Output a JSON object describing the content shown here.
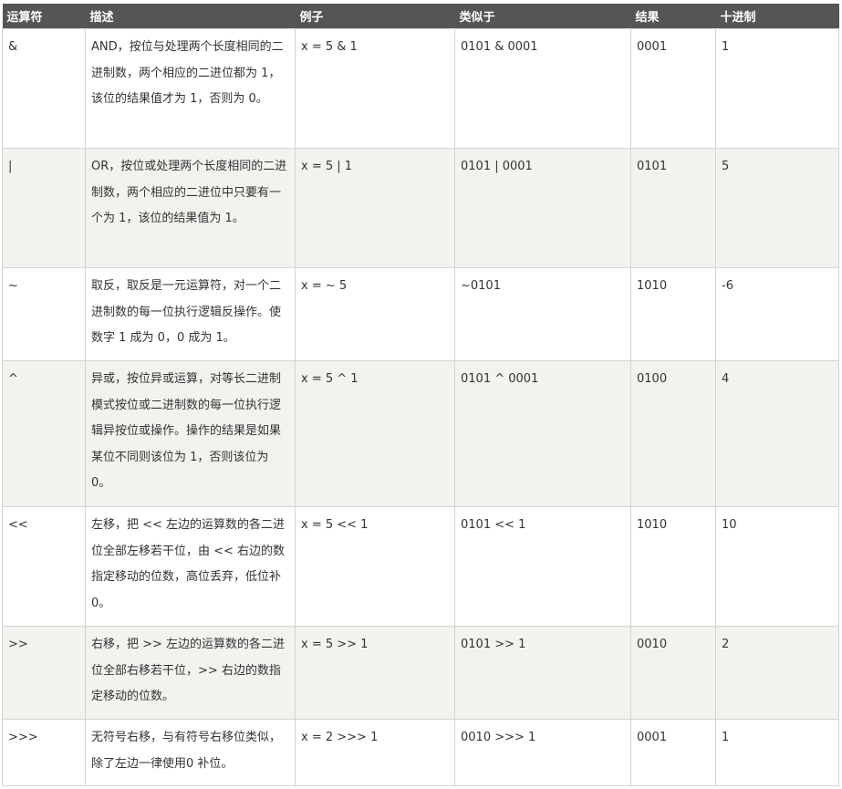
{
  "table": {
    "headers": [
      "运算符",
      "描述",
      "例子",
      "类似于",
      "结果",
      "十进制"
    ],
    "rows": [
      {
        "operator": "&",
        "description": "AND，按位与处理两个长度相同的二进制数，两个相应的二进位都为 1，该位的结果值才为 1，否则为 0。",
        "example": "x = 5 & 1",
        "similar": "0101 & 0001",
        "result": "0001",
        "decimal": "1"
      },
      {
        "operator": "|",
        "description": "OR，按位或处理两个长度相同的二进制数，两个相应的二进位中只要有一个为 1，该位的结果值为 1。",
        "example": "x = 5 | 1",
        "similar": "0101 | 0001",
        "result": "0101",
        "decimal": "5"
      },
      {
        "operator": "~",
        "description": "取反，取反是一元运算符，对一个二进制数的每一位执行逻辑反操作。使数字 1 成为 0，0 成为 1。",
        "example": "x = ~ 5",
        "similar": " ~0101",
        "result": "1010",
        "decimal": "-6"
      },
      {
        "operator": "^",
        "description": "异或，按位异或运算，对等长二进制模式按位或二进制数的每一位执行逻辑异按位或操作。操作的结果是如果某位不同则该位为 1，否则该位为 0。",
        "example": "x = 5 ^ 1",
        "similar": "0101 ^ 0001",
        "result": "0100",
        "decimal": "4"
      },
      {
        "operator": "<<",
        "description": "左移，把 << 左边的运算数的各二进位全部左移若干位，由 << 右边的数指定移动的位数，高位丢弃，低位补 0。",
        "example": "x = 5 << 1",
        "similar": "0101 << 1",
        "result": "1010",
        "decimal": "10"
      },
      {
        "operator": ">>",
        "description": "右移，把 >> 左边的运算数的各二进位全部右移若干位，>> 右边的数指定移动的位数。",
        "example": "x = 5 >> 1",
        "similar": "0101 >> 1",
        "result": "0010",
        "decimal": "2"
      },
      {
        "operator": ">>>",
        "description": "无符号右移，与有符号右移位类似，除了左边一律使用0 补位。",
        "example": "x = 2 >>> 1",
        "similar": "0010 >>> 1",
        "result": "0001",
        "decimal": "1"
      }
    ]
  }
}
